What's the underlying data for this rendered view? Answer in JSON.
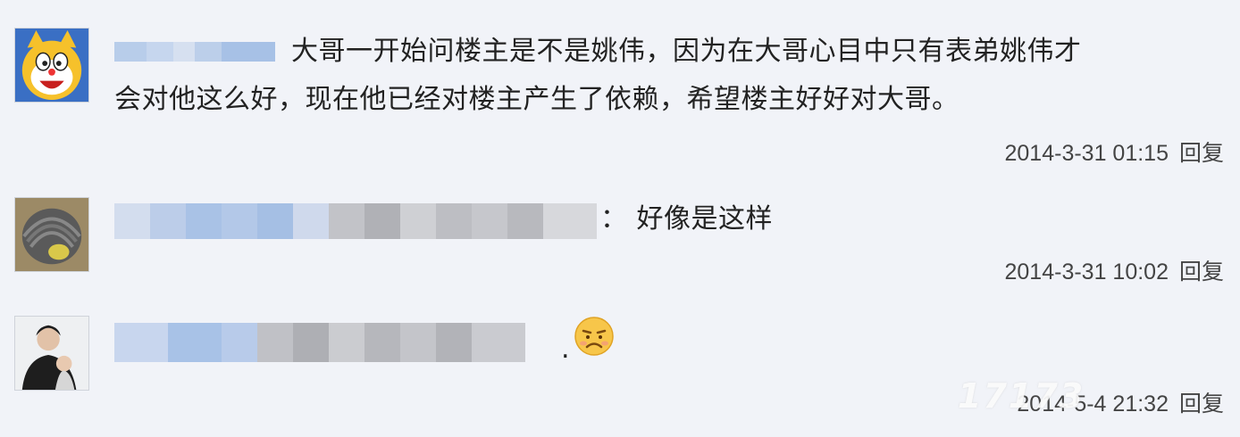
{
  "comments": [
    {
      "text_line1": "大哥一开始问楼主是不是姚伟，因为在大哥心目中只有表弟姚伟才",
      "text_line2": "会对他这么好，现在他已经对楼主产生了依赖，希望楼主好好对大哥。",
      "timestamp": "2014-3-31 01:15",
      "reply_label": "回复"
    },
    {
      "text": "： 好像是这样",
      "timestamp": "2014-3-31 10:02",
      "reply_label": "回复"
    },
    {
      "text": ".",
      "emoji": "pouting-face-emoji",
      "timestamp": "2014-5-4 21:32",
      "reply_label": "回复"
    }
  ],
  "watermark": "17173",
  "colors": {
    "background": "#f1f3f8",
    "blur_blue": "#a9c4e8",
    "blur_gray": "#c8c8cc"
  }
}
